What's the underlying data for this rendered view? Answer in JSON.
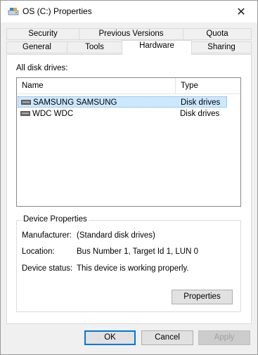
{
  "window": {
    "title": "OS (C:) Properties",
    "title_icon": "drive-icon",
    "close_glyph": "✕"
  },
  "tabs": {
    "row1": [
      {
        "label": "Security"
      },
      {
        "label": "Previous Versions"
      },
      {
        "label": "Quota"
      }
    ],
    "row2": [
      {
        "label": "General"
      },
      {
        "label": "Tools"
      },
      {
        "label": "Hardware",
        "active": true
      },
      {
        "label": "Sharing"
      }
    ]
  },
  "hardware": {
    "list_label": "All disk drives:",
    "columns": {
      "name": "Name",
      "type": "Type"
    },
    "drives": [
      {
        "name": "SAMSUNG SAMSUNG",
        "type": "Disk drives",
        "selected": true
      },
      {
        "name": "WDC WDC",
        "type": "Disk drives",
        "selected": false
      }
    ],
    "device_properties": {
      "title": "Device Properties",
      "manufacturer_label": "Manufacturer:",
      "manufacturer_value": "(Standard disk drives)",
      "location_label": "Location:",
      "location_value": "Bus Number 1, Target Id 1, LUN 0",
      "status_label": "Device status:",
      "status_value": "This device is working properly.",
      "properties_button": "Properties"
    }
  },
  "footer": {
    "ok": "OK",
    "cancel": "Cancel",
    "apply": "Apply"
  },
  "colors": {
    "selection": "#cce8ff",
    "default_button_border": "#0078d7"
  }
}
